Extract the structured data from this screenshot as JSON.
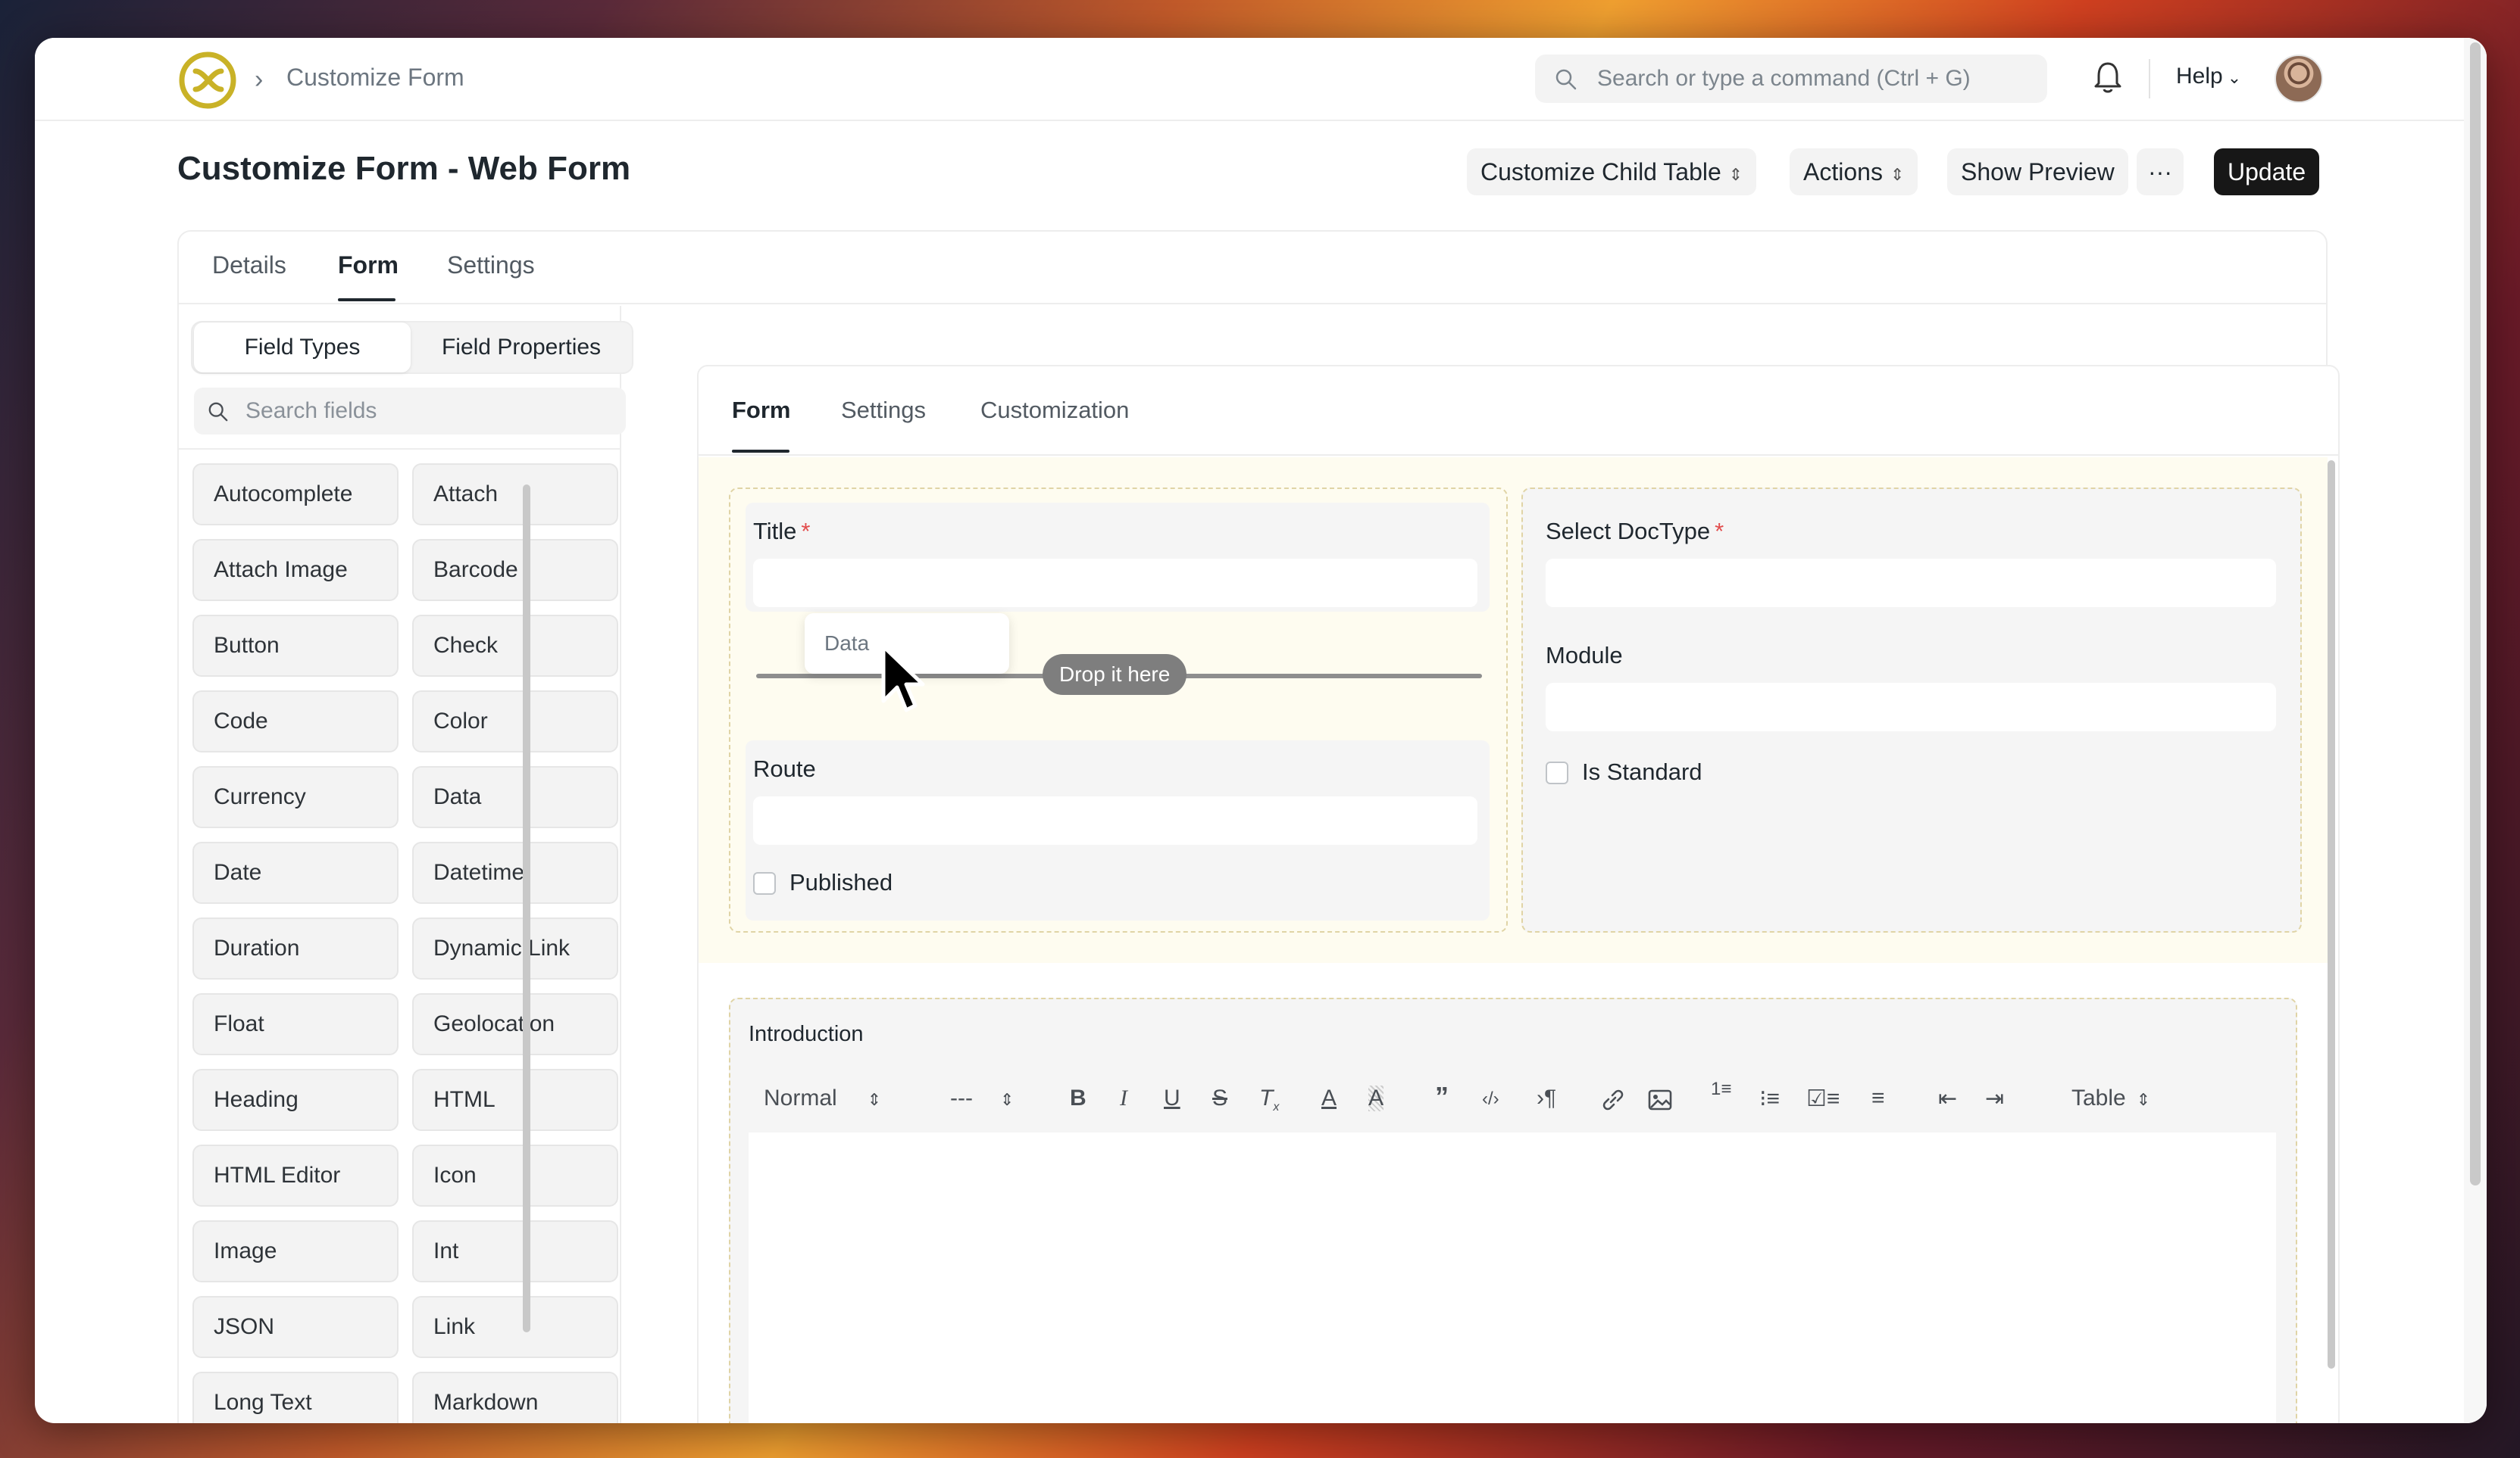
{
  "navbar": {
    "breadcrumb": "Customize Form",
    "search_placeholder": "Search or type a command (Ctrl + G)",
    "help_label": "Help"
  },
  "header": {
    "title": "Customize Form - Web Form",
    "buttons": {
      "customize_child_table": "Customize Child Table",
      "actions": "Actions",
      "show_preview": "Show Preview",
      "more": "···",
      "update": "Update"
    }
  },
  "tabs": [
    "Details",
    "Form",
    "Settings"
  ],
  "sidebar": {
    "segments": [
      "Field Types",
      "Field Properties"
    ],
    "search_placeholder": "Search fields",
    "field_types": [
      "Autocomplete",
      "Attach",
      "Attach Image",
      "Barcode",
      "Button",
      "Check",
      "Code",
      "Color",
      "Currency",
      "Data",
      "Date",
      "Datetime",
      "Duration",
      "Dynamic Link",
      "Float",
      "Geolocation",
      "Heading",
      "HTML",
      "HTML Editor",
      "Icon",
      "Image",
      "Int",
      "JSON",
      "Link",
      "Long Text",
      "Markdown"
    ]
  },
  "builder": {
    "tabs": [
      "Form",
      "Settings",
      "Customization"
    ],
    "left_column": {
      "title_label": "Title",
      "route_label": "Route",
      "published_label": "Published",
      "drag_ghost": "Data",
      "drop_hint": "Drop it here"
    },
    "right_column": {
      "doctype_label": "Select DocType",
      "module_label": "Module",
      "is_standard_label": "Is Standard"
    },
    "introduction": {
      "label": "Introduction",
      "toolbar": {
        "text_style": "Normal",
        "font_size": "---",
        "table": "Table"
      }
    }
  },
  "colors": {
    "accent": "#171717",
    "required": "#e24c4c",
    "highlight": "#fefcf0"
  }
}
